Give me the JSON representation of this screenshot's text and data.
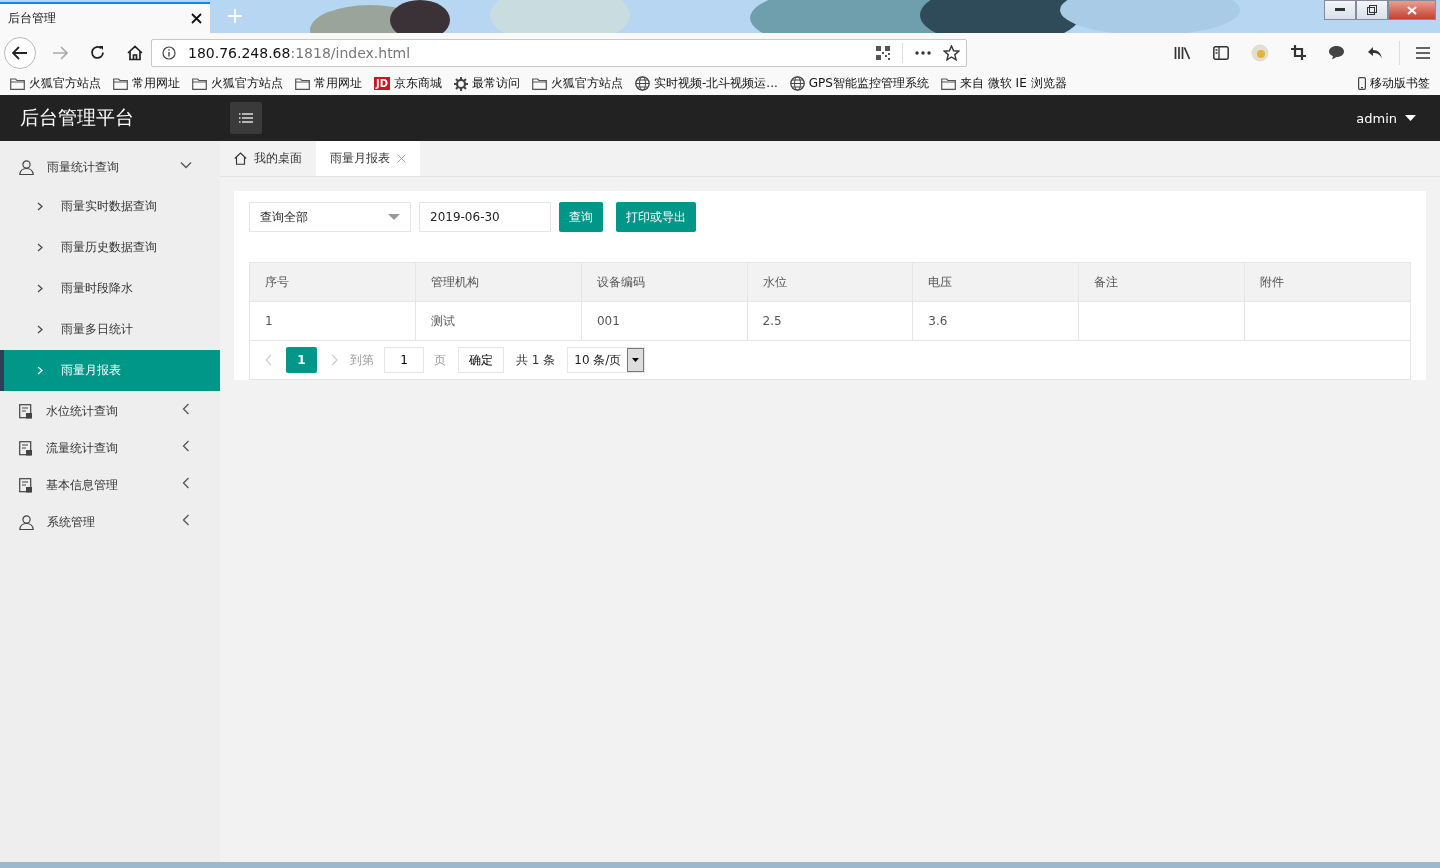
{
  "browser": {
    "tab_title": "后台管理",
    "url_host": "180.76.248.68",
    "url_rest": ":1818/index.html",
    "bookmarks": [
      {
        "kind": "folder",
        "label": "火狐官方站点"
      },
      {
        "kind": "folder",
        "label": "常用网址"
      },
      {
        "kind": "folder",
        "label": "火狐官方站点"
      },
      {
        "kind": "folder",
        "label": "常用网址"
      },
      {
        "kind": "jd",
        "label": "京东商城",
        "badge": "JD"
      },
      {
        "kind": "gear",
        "label": "最常访问"
      },
      {
        "kind": "folder",
        "label": "火狐官方站点"
      },
      {
        "kind": "globe",
        "label": "实时视频-北斗视频运..."
      },
      {
        "kind": "globe",
        "label": "GPS智能监控管理系统"
      },
      {
        "kind": "folder",
        "label": "来自 微软 IE 浏览器"
      }
    ],
    "mobile_bookmarks": "移动版书签"
  },
  "app": {
    "title": "后台管理平台",
    "user": "admin"
  },
  "sidebar": [
    {
      "kind": "user",
      "label": "雨量统计查询",
      "expanded": true,
      "children": [
        {
          "label": "雨量实时数据查询",
          "selected": false
        },
        {
          "label": "雨量历史数据查询",
          "selected": false
        },
        {
          "label": "雨量时段降水",
          "selected": false
        },
        {
          "label": "雨量多日统计",
          "selected": false
        },
        {
          "label": "雨量月报表",
          "selected": true
        }
      ]
    },
    {
      "kind": "doc",
      "label": "水位统计查询",
      "expanded": false
    },
    {
      "kind": "doc",
      "label": "流量统计查询",
      "expanded": false
    },
    {
      "kind": "doc",
      "label": "基本信息管理",
      "expanded": false
    },
    {
      "kind": "user",
      "label": "系统管理",
      "expanded": false
    }
  ],
  "tabs": [
    {
      "label": "我的桌面",
      "kind": "home",
      "selected": false
    },
    {
      "label": "雨量月报表",
      "kind": "closable",
      "selected": true
    }
  ],
  "filters": {
    "select": "查询全部",
    "date": "2019-06-30",
    "buttons": [
      "查询",
      "打印或导出"
    ]
  },
  "table": {
    "columns": [
      "序号",
      "管理机构",
      "设备编码",
      "水位",
      "电压",
      "备注",
      "附件"
    ],
    "rows": [
      [
        "1",
        "测试",
        "001",
        "2.5",
        "3.6",
        "",
        ""
      ]
    ]
  },
  "pager": {
    "current": "1",
    "goto_label": "到第",
    "goto_value": "1",
    "page_label": "页",
    "confirm": "确定",
    "total": "共 1 条",
    "page_size": "10 条/页"
  }
}
